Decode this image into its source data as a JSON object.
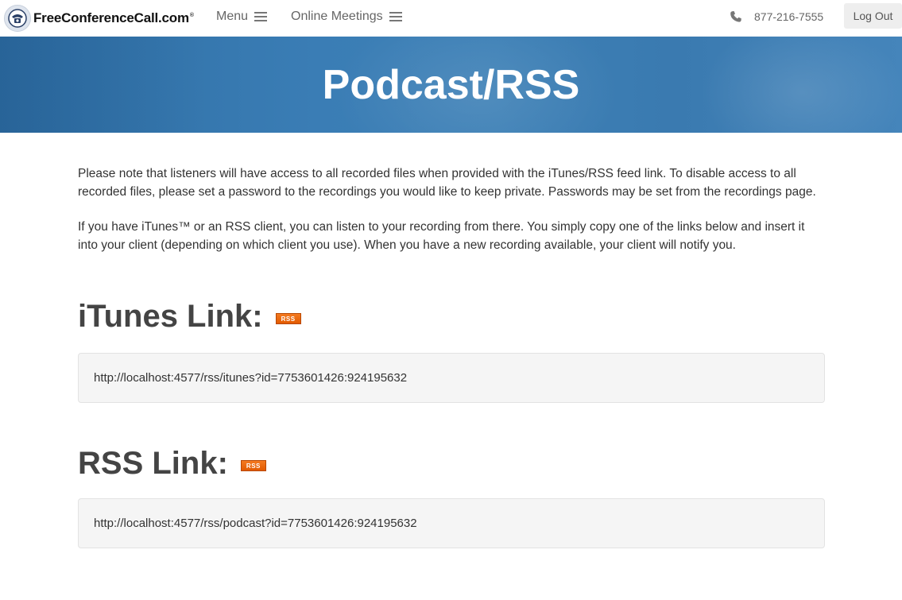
{
  "header": {
    "logo_text": "FreeConferenceCall.com",
    "logo_mark": "®",
    "menu_label": "Menu",
    "meetings_label": "Online Meetings",
    "phone_number": "877-216-7555",
    "logout_label": "Log Out"
  },
  "banner": {
    "title": "Podcast/RSS"
  },
  "main": {
    "paragraph_1": "Please note that listeners will have access to all recorded files when provided with the iTunes/RSS feed link. To disable access to all recorded files, please set a password to the recordings you would like to keep private. Passwords may be set from the recordings page.",
    "paragraph_2": "If you have iTunes™ or an RSS client, you can listen to your recording from there. You simply copy one of the links below and insert it into your client (depending on which client you use). When you have a new recording available, your client will notify you.",
    "itunes_heading": "iTunes Link:",
    "itunes_rss_badge": "RSS",
    "itunes_url": "http://localhost:4577/rss/itunes?id=7753601426:924195632",
    "rss_heading": "RSS Link:",
    "rss_rss_badge": "RSS",
    "rss_url": "http://localhost:4577/rss/podcast?id=7753601426:924195632"
  },
  "icons": {
    "logo": "telephone-logo-icon",
    "menu": "hamburger-icon",
    "phone": "phone-icon",
    "rss": "rss-badge-icon"
  },
  "colors": {
    "banner_blue": "#3a7db5",
    "rss_orange": "#f47a20",
    "heading_gray": "#444444"
  }
}
